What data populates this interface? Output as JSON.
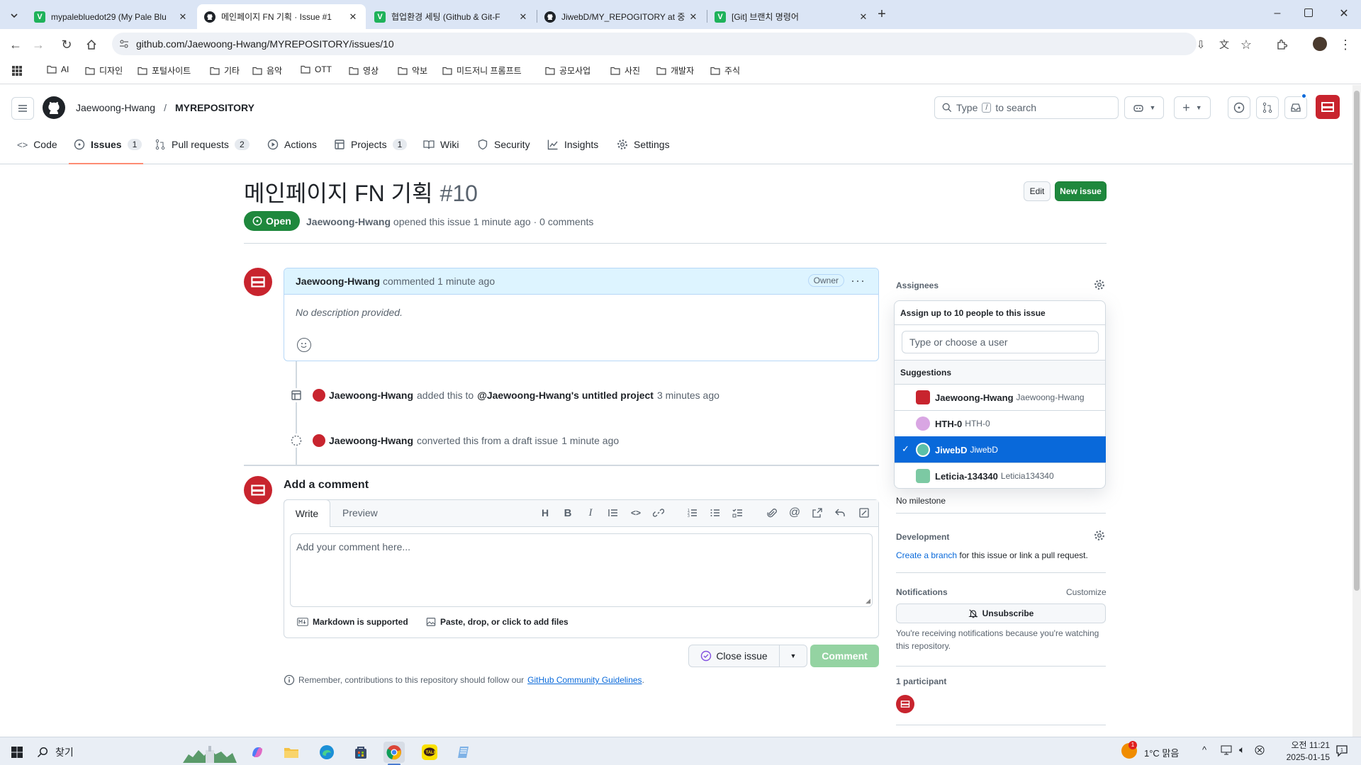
{
  "browser": {
    "tabs": [
      {
        "title": "mypalebluedot29 (My Pale Blu",
        "icon": "V",
        "icon_color": "#1fb25a"
      },
      {
        "title": "메인페이지 FN 기획 · Issue #1",
        "icon": "github-icon",
        "icon_color": "#1f2328"
      },
      {
        "title": "협업환경 세팅 (Github & Git-F",
        "icon": "V",
        "icon_color": "#1fb25a"
      },
      {
        "title": "JiwebD/MY_REPOGITORY at 중",
        "icon": "github-icon",
        "icon_color": "#1f2328"
      },
      {
        "title": "[Git] 브랜치 명령어",
        "icon": "V",
        "icon_color": "#1fb25a"
      }
    ],
    "url": "github.com/Jaewoong-Hwang/MYREPOSITORY/issues/10",
    "bookmarks": [
      "AI",
      "디자인",
      "포털사이트",
      "기타",
      "음악",
      "OTT",
      "영상",
      "악보",
      "미드저니 프롬프트",
      "공모사업",
      "사진",
      "개발자",
      "주식"
    ]
  },
  "github": {
    "owner": "Jaewoong-Hwang",
    "repo": "MYREPOSITORY",
    "search_placeholder_pre": "Type",
    "search_key": "/",
    "search_placeholder_post": "to search",
    "nav": [
      {
        "label": "Code",
        "count": ""
      },
      {
        "label": "Issues",
        "count": "1"
      },
      {
        "label": "Pull requests",
        "count": "2"
      },
      {
        "label": "Actions",
        "count": ""
      },
      {
        "label": "Projects",
        "count": "1"
      },
      {
        "label": "Wiki",
        "count": ""
      },
      {
        "label": "Security",
        "count": ""
      },
      {
        "label": "Insights",
        "count": ""
      },
      {
        "label": "Settings",
        "count": ""
      }
    ]
  },
  "issue": {
    "title": "메인페이지 FN 기획",
    "number": "#10",
    "edit_label": "Edit",
    "new_issue_label": "New issue",
    "state": "Open",
    "author": "Jaewoong-Hwang",
    "opened_text": "opened this issue 1 minute ago · 0 comments",
    "comment": {
      "author": "Jaewoong-Hwang",
      "action": "commented",
      "time": "1 minute ago",
      "role": "Owner",
      "body": "No description provided."
    },
    "events": [
      {
        "actor": "Jaewoong-Hwang",
        "pre": "added this to",
        "target": "@Jaewoong-Hwang's untitled project",
        "time": "3 minutes ago"
      },
      {
        "actor": "Jaewoong-Hwang",
        "pre": "converted this from a draft issue",
        "target": "",
        "time": "1 minute ago"
      }
    ],
    "add_comment": {
      "heading": "Add a comment",
      "tab_write": "Write",
      "tab_preview": "Preview",
      "placeholder": "Add your comment here...",
      "markdown_label": "Markdown is supported",
      "attach_label": "Paste, drop, or click to add files",
      "close_label": "Close issue",
      "comment_label": "Comment"
    },
    "footer_note_pre": "Remember, contributions to this repository should follow our",
    "footer_link": "GitHub Community Guidelines",
    "footer_note_post": "."
  },
  "sidebar": {
    "assignees_label": "Assignees",
    "dropdown": {
      "header": "Assign up to 10 people to this issue",
      "input_placeholder": "Type or choose a user",
      "suggestions_label": "Suggestions",
      "users": [
        {
          "name": "Jaewoong-Hwang",
          "login": "Jaewoong-Hwang",
          "selected": false,
          "color": "#c8242e"
        },
        {
          "name": "HTH-0",
          "login": "HTH-0",
          "selected": false,
          "color": "#d9a6e3"
        },
        {
          "name": "JiwebD",
          "login": "JiwebD",
          "selected": true,
          "color": "#5bc0a8"
        },
        {
          "name": "Leticia-134340",
          "login": "Leticia134340",
          "selected": false,
          "color": "#7cc9a3"
        }
      ]
    },
    "milestone_text": "No milestone",
    "development_label": "Development",
    "create_branch": "Create a branch",
    "development_text": "for this issue or link a pull request.",
    "notifications_label": "Notifications",
    "customize_label": "Customize",
    "unsubscribe_label": "Unsubscribe",
    "notify_text": "You're receiving notifications because you're watching this repository.",
    "participants_label": "1 participant"
  },
  "taskbar": {
    "search_label": "찾기",
    "weather": "1°C  맑음",
    "time": "오전 11:21",
    "date": "2025-01-15",
    "notif_count": "1"
  }
}
